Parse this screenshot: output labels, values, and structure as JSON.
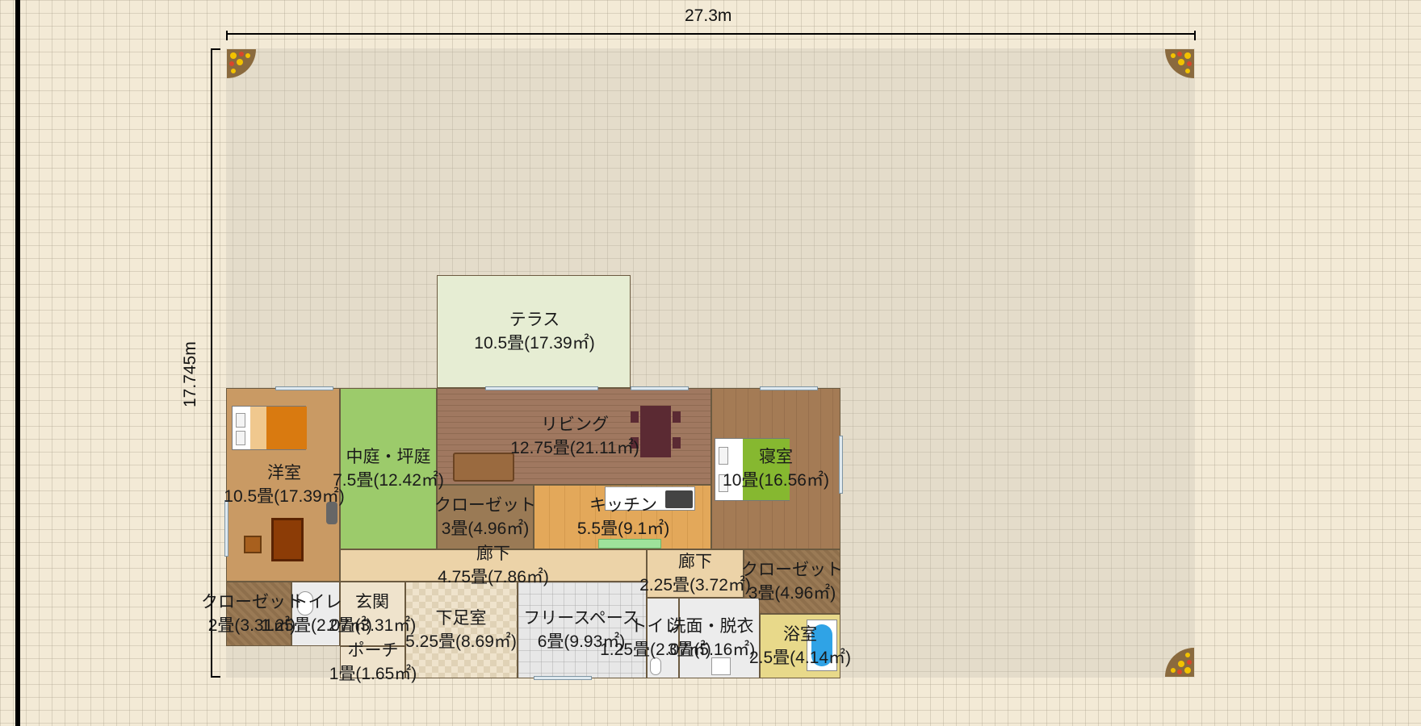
{
  "dimensions": {
    "width": "27.3m",
    "height": "17.745m"
  },
  "rooms": [
    {
      "name": "テラス",
      "area": "10.5畳(17.39㎡)"
    },
    {
      "name": "洋室",
      "area": "10.5畳(17.39㎡)"
    },
    {
      "name": "中庭・坪庭",
      "area": "7.5畳(12.42㎡)"
    },
    {
      "name": "リビング",
      "area": "12.75畳(21.11㎡)"
    },
    {
      "name": "寝室",
      "area": "10畳(16.56㎡)"
    },
    {
      "name": "クローゼット",
      "area": "3畳(4.96㎡)"
    },
    {
      "name": "キッチン",
      "area": "5.5畳(9.1㎡)"
    },
    {
      "name": "廊下",
      "area": "4.75畳(7.86㎡)"
    },
    {
      "name": "廊下",
      "area": "2.25畳(3.72㎡)"
    },
    {
      "name": "クローゼット",
      "area": "3畳(4.96㎡)"
    },
    {
      "name": "クローゼット",
      "area": "2畳(3.31㎡)"
    },
    {
      "name": "トイレ",
      "area": "1.25畳(2.07㎡)"
    },
    {
      "name": "玄関",
      "area": "2畳(3.31㎡)"
    },
    {
      "name": "下足室",
      "area": "5.25畳(8.69㎡)"
    },
    {
      "name": "フリースペース",
      "area": "6畳(9.93㎡)"
    },
    {
      "name": "トイレ",
      "area": "1.25畳(2.07㎡)"
    },
    {
      "name": "洗面・脱衣",
      "area": "3畳(5.16㎡)"
    },
    {
      "name": "浴室",
      "area": "2.5畳(4.14㎡)"
    },
    {
      "name": "ポーチ",
      "area": "1畳(1.65㎡)"
    }
  ],
  "colors": {
    "terrace": "#e6edd3",
    "garden": "#9ccb6b",
    "bedroom_wood": "#a47b55",
    "living_floor": "#a07860",
    "kitchen_floor": "#e3a85a",
    "hallway": "#ecd3a8",
    "closet": "#9a7a55",
    "tile": "#e7e7e7",
    "entry": "#efe3cc",
    "bath_water": "#2fa3e6"
  }
}
